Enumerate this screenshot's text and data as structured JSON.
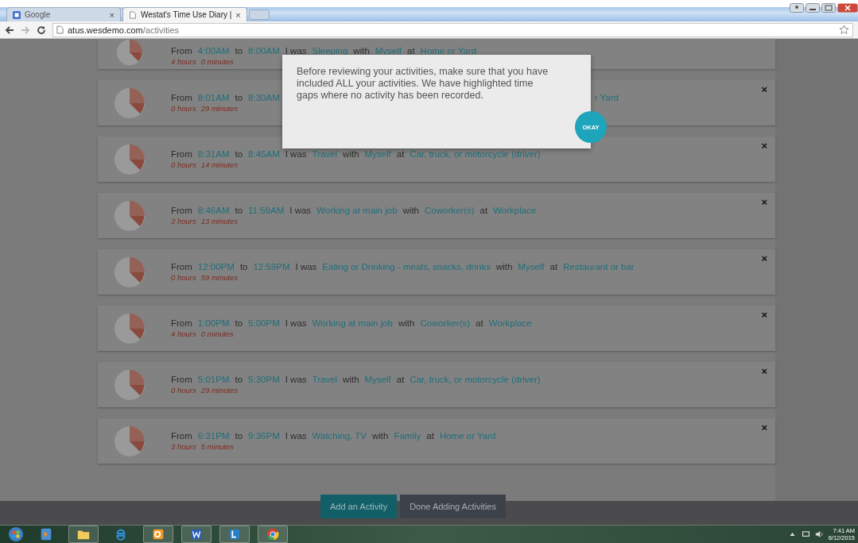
{
  "browser": {
    "tabs": [
      {
        "title": "Google",
        "close": "×",
        "selected": false
      },
      {
        "title": "Westat's Time Use Diary |",
        "close": "×",
        "selected": true
      }
    ],
    "address": {
      "domain": "atus.wesdemo.com",
      "path": "/activities"
    }
  },
  "activities": [
    {
      "kind": "full",
      "from_label": "From",
      "from": "4:00AM",
      "to_label": "to",
      "to": "8:00AM",
      "was_label": "I was",
      "activity": "Sleeping",
      "with_label": "with",
      "with": "Myself",
      "at_label": "at",
      "place": "Home or Yard",
      "hours": "4 hours",
      "minutes": "0 minutes",
      "closable": false
    },
    {
      "kind": "covered",
      "from_label": "From",
      "from": "8:01AM",
      "to_label": "to",
      "to": "8:30AM",
      "tail": "r Yard",
      "hours": "0 hours",
      "minutes": "29 minutes",
      "closable": true
    },
    {
      "kind": "full",
      "from_label": "From",
      "from": "8:31AM",
      "to_label": "to",
      "to": "8:45AM",
      "was_label": "I was",
      "activity": "Travel",
      "with_label": "with",
      "with": "Myself",
      "at_label": "at",
      "place": "Car, truck, or motorcycle (driver)",
      "hours": "0 hours",
      "minutes": "14 minutes",
      "closable": true
    },
    {
      "kind": "full",
      "from_label": "From",
      "from": "8:46AM",
      "to_label": "to",
      "to": "11:59AM",
      "was_label": "I was",
      "activity": "Working at main job",
      "with_label": "with",
      "with": "Coworker(s)",
      "at_label": "at",
      "place": "Workplace",
      "hours": "3 hours",
      "minutes": "13 minutes",
      "closable": true
    },
    {
      "kind": "full",
      "from_label": "From",
      "from": "12:00PM",
      "to_label": "to",
      "to": "12:59PM",
      "was_label": "I was",
      "activity": "Eating or Drinking - meals, snacks, drinks",
      "with_label": "with",
      "with": "Myself",
      "at_label": "at",
      "place": "Restaurant or bar",
      "hours": "0 hours",
      "minutes": "59 minutes",
      "closable": true
    },
    {
      "kind": "full",
      "from_label": "From",
      "from": "1:00PM",
      "to_label": "to",
      "to": "5:00PM",
      "was_label": "I was",
      "activity": "Working at main job",
      "with_label": "with",
      "with": "Coworker(s)",
      "at_label": "at",
      "place": "Workplace",
      "hours": "4 hours",
      "minutes": "0 minutes",
      "closable": true
    },
    {
      "kind": "full",
      "from_label": "From",
      "from": "5:01PM",
      "to_label": "to",
      "to": "5:30PM",
      "was_label": "I was",
      "activity": "Travel",
      "with_label": "with",
      "with": "Myself",
      "at_label": "at",
      "place": "Car, truck, or motorcycle (driver)",
      "hours": "0 hours",
      "minutes": "29 minutes",
      "closable": true
    },
    {
      "kind": "full",
      "from_label": "From",
      "from": "6:31PM",
      "to_label": "to",
      "to": "9:36PM",
      "was_label": "I was",
      "activity": "Watching, TV",
      "with_label": "with",
      "with": "Family",
      "at_label": "at",
      "place": "Home or Yard",
      "hours": "3 hours",
      "minutes": "5 minutes",
      "closable": true
    }
  ],
  "close_mark": "×",
  "dialog": {
    "message": "Before reviewing your activities, make sure that you have included ALL your activities. We have highlighted time gaps where no activity has been recorded.",
    "button": "OKAY"
  },
  "footer_buttons": [
    {
      "label": "Add an Activity",
      "kind": "primary"
    },
    {
      "label": "Done Adding Activities",
      "kind": "secondary"
    }
  ],
  "taskbar": {
    "time": "7:41 AM",
    "date": "6/12/2015"
  }
}
